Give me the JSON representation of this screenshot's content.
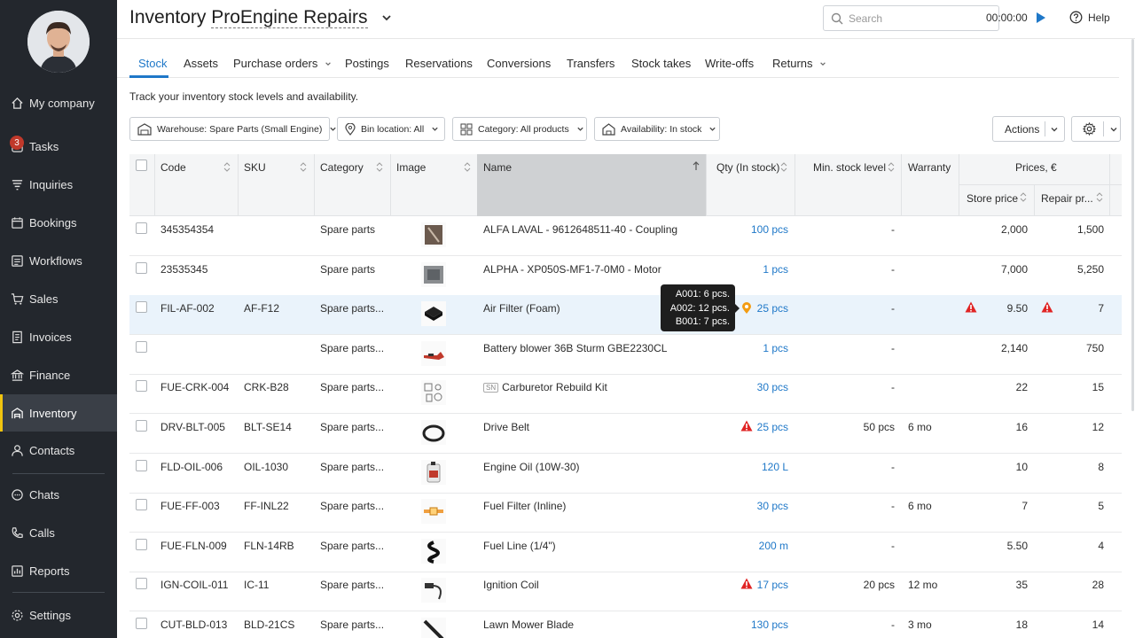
{
  "sidebar": {
    "items": [
      {
        "label": "My company",
        "icon": "home-icon"
      },
      {
        "label": "Tasks",
        "icon": "tasks-icon",
        "badge": "3"
      },
      {
        "label": "Inquiries",
        "icon": "funnel-icon"
      },
      {
        "label": "Bookings",
        "icon": "calendar-icon"
      },
      {
        "label": "Workflows",
        "icon": "workflow-icon"
      },
      {
        "label": "Sales",
        "icon": "cart-icon"
      },
      {
        "label": "Invoices",
        "icon": "invoice-icon"
      },
      {
        "label": "Finance",
        "icon": "finance-icon"
      },
      {
        "label": "Inventory",
        "icon": "inventory-icon"
      },
      {
        "label": "Contacts",
        "icon": "contacts-icon"
      },
      {
        "label": "Chats",
        "icon": "chat-icon"
      },
      {
        "label": "Calls",
        "icon": "phone-icon"
      },
      {
        "label": "Reports",
        "icon": "reports-icon"
      },
      {
        "label": "Settings",
        "icon": "settings-icon"
      }
    ],
    "active": "Inventory",
    "accent": "#f1c40f"
  },
  "header": {
    "title_prefix": "Inventory",
    "title_location": "ProEngine Repairs",
    "search_placeholder": "Search",
    "timer": "00:00:00",
    "help": "Help"
  },
  "tabs": [
    {
      "label": "Stock",
      "active": true
    },
    {
      "label": "Assets"
    },
    {
      "label": "Purchase orders",
      "dropdown": true
    },
    {
      "label": "Postings"
    },
    {
      "label": "Reservations"
    },
    {
      "label": "Conversions"
    },
    {
      "label": "Transfers"
    },
    {
      "label": "Stock takes"
    },
    {
      "label": "Write-offs"
    },
    {
      "label": "Returns",
      "dropdown": true
    }
  ],
  "subtitle": "Track your inventory stock levels and availability.",
  "filters": {
    "warehouse": "Warehouse: Spare Parts (Small Engine)",
    "bin": "Bin location: All",
    "category": "Category: All products",
    "availability": "Availability: In stock"
  },
  "actions_label": "Actions",
  "table": {
    "headers": {
      "code": "Code",
      "sku": "SKU",
      "category": "Category",
      "image": "Image",
      "name": "Name",
      "qty": "Qty (In stock)",
      "min": "Min. stock level",
      "warranty": "Warranty",
      "prices": "Prices, €",
      "store": "Store price",
      "repair": "Repair pr..."
    },
    "rows": [
      {
        "code": "345354354",
        "sku": "",
        "category": "Spare parts",
        "name": "ALFA LAVAL - 9612648511-40 - Coupling",
        "qty": "100 pcs",
        "min": "-",
        "warranty": "",
        "store": "2,000",
        "repair": "1,500"
      },
      {
        "code": "23535345",
        "sku": "",
        "category": "Spare parts",
        "name": "ALPHA - XP050S-MF1-7-0M0 - Motor",
        "qty": "1 pcs",
        "min": "-",
        "warranty": "",
        "store": "7,000",
        "repair": "5,250"
      },
      {
        "code": "FIL-AF-002",
        "sku": "AF-F12",
        "category": "Spare parts...",
        "name": "Air Filter (Foam)",
        "qty": "25 pcs",
        "min": "-",
        "warranty": "",
        "store": "9.50",
        "repair": "7"
      },
      {
        "code": "",
        "sku": "",
        "category": "Spare parts...",
        "name": "Battery blower 36B Sturm GBE2230CL",
        "qty": "1 pcs",
        "min": "-",
        "warranty": "",
        "store": "2,140",
        "repair": "750"
      },
      {
        "code": "FUE-CRK-004",
        "sku": "CRK-B28",
        "category": "Spare parts...",
        "name": "Carburetor Rebuild Kit",
        "qty": "30 pcs",
        "min": "-",
        "warranty": "",
        "store": "22",
        "repair": "15"
      },
      {
        "code": "DRV-BLT-005",
        "sku": "BLT-SE14",
        "category": "Spare parts...",
        "name": "Drive Belt",
        "qty": "25 pcs",
        "min": "50 pcs",
        "warranty": "6 mo",
        "store": "16",
        "repair": "12"
      },
      {
        "code": "FLD-OIL-006",
        "sku": "OIL-1030",
        "category": "Spare parts...",
        "name": "Engine Oil (10W-30)",
        "qty": "120 L",
        "min": "-",
        "warranty": "",
        "store": "10",
        "repair": "8"
      },
      {
        "code": "FUE-FF-003",
        "sku": "FF-INL22",
        "category": "Spare parts...",
        "name": "Fuel Filter (Inline)",
        "qty": "30 pcs",
        "min": "-",
        "warranty": "6 mo",
        "store": "7",
        "repair": "5"
      },
      {
        "code": "FUE-FLN-009",
        "sku": "FLN-14RB",
        "category": "Spare parts...",
        "name": "Fuel Line (1/4\")",
        "qty": "200 m",
        "min": "-",
        "warranty": "",
        "store": "5.50",
        "repair": "4"
      },
      {
        "code": "IGN-COIL-011",
        "sku": "IC-11",
        "category": "Spare parts...",
        "name": "Ignition Coil",
        "qty": "17 pcs",
        "min": "20 pcs",
        "warranty": "12 mo",
        "store": "35",
        "repair": "28"
      },
      {
        "code": "CUT-BLD-013",
        "sku": "BLD-21CS",
        "category": "Spare parts...",
        "name": "Lawn Mower Blade",
        "qty": "130 pcs",
        "min": "-",
        "warranty": "3 mo",
        "store": "18",
        "repair": "14"
      }
    ],
    "sn_tag": "SN"
  },
  "tooltip": {
    "lines": [
      "A001: 6 pcs.",
      "A002: 12 pcs.",
      "B001: 7 pcs."
    ]
  },
  "colors": {
    "link": "#1f78c8",
    "warning": "#e02424",
    "pin": "#f39c12",
    "sidebar_bg": "#23272d"
  }
}
